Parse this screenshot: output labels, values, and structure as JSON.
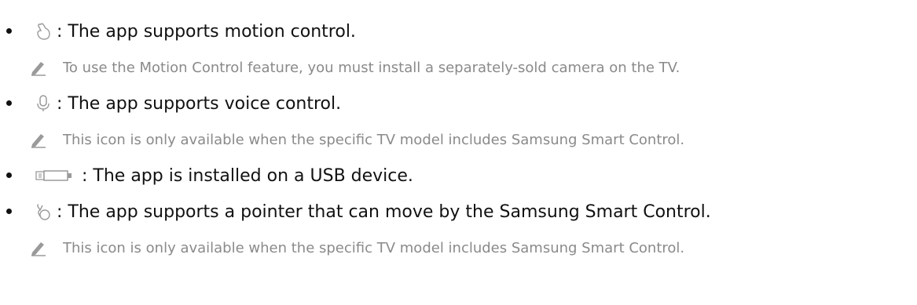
{
  "items": [
    {
      "icon": "motion-hand-icon",
      "text": " : The app supports motion control.",
      "note": "To use the Motion Control feature, you must install a separately-sold camera on the TV."
    },
    {
      "icon": "microphone-icon",
      "text": " : The app supports voice control.",
      "note": "This icon is only available when the specific TV model includes Samsung Smart Control."
    },
    {
      "icon": "usb-icon",
      "text": " : The app is installed on a USB device."
    },
    {
      "icon": "pointer-icon",
      "text": " : The app supports a pointer that can move by the Samsung Smart Control.",
      "note": "This icon is only available when the specific TV model includes Samsung Smart Control."
    }
  ],
  "note_icon": "pencil-icon",
  "colors": {
    "main_text": "#111111",
    "note_text": "#8a8a8a",
    "icon_gray": "#9a9a9a"
  }
}
